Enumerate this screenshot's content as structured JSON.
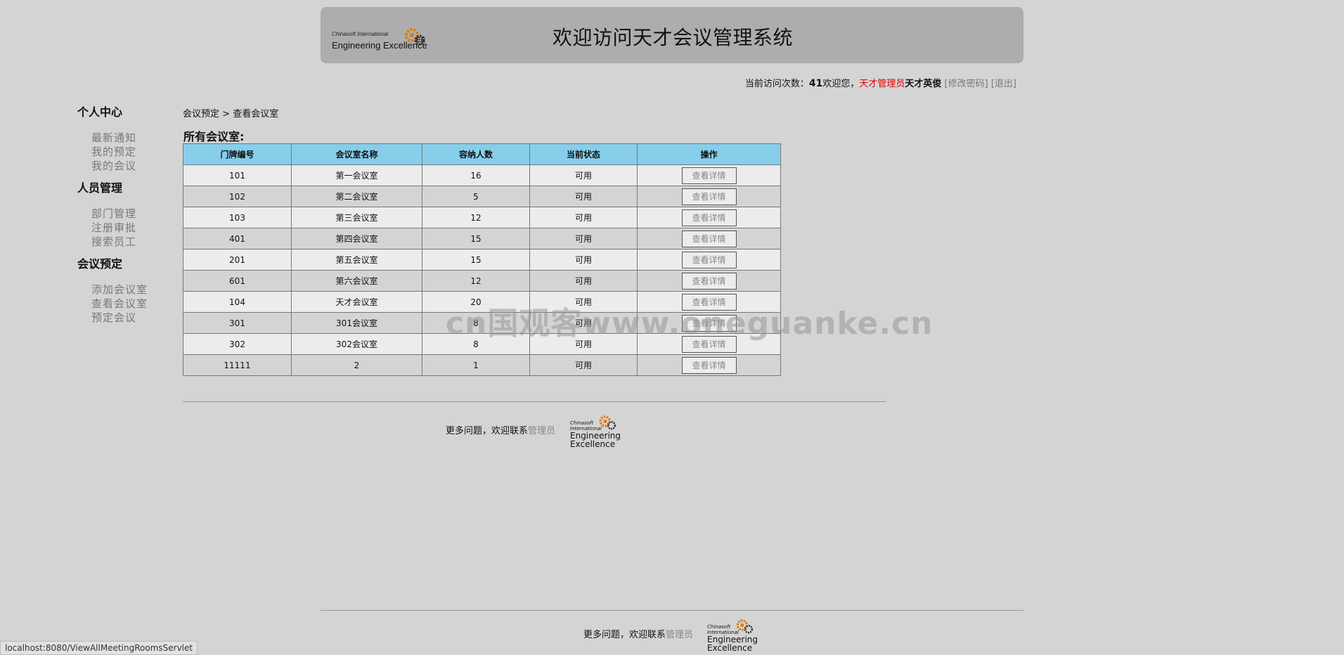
{
  "header": {
    "logo_line1": "Chinasoft International",
    "logo_line2": "Engineering Excellence",
    "title": "欢迎访问天才会议管理系统"
  },
  "status_line": {
    "visits_label": "当前访问次数：",
    "visits_count": "41",
    "welcome": "欢迎您，",
    "role": "天才管理员",
    "username": "天才英俊",
    "change_password": "[修改密码]",
    "logout": "[退出]"
  },
  "sidebar": {
    "groups": [
      {
        "title": "个人中心",
        "items": [
          "最新通知",
          "我的预定",
          "我的会议"
        ]
      },
      {
        "title": "人员管理",
        "items": [
          "部门管理",
          "注册审批",
          "搜索员工"
        ]
      },
      {
        "title": "会议预定",
        "items": [
          "添加会议室",
          "查看会议室",
          "预定会议"
        ]
      }
    ]
  },
  "breadcrumb": {
    "parent": "会议预定",
    "sep": " > ",
    "current": "查看会议室"
  },
  "section_title": "所有会议室:",
  "table": {
    "headers": [
      "门牌编号",
      "会议室名称",
      "容纳人数",
      "当前状态",
      "操作"
    ],
    "action_label": "查看详情",
    "rows": [
      {
        "no": "101",
        "name": "第一会议室",
        "cap": "16",
        "status": "可用"
      },
      {
        "no": "102",
        "name": "第二会议室",
        "cap": "5",
        "status": "可用"
      },
      {
        "no": "103",
        "name": "第三会议室",
        "cap": "12",
        "status": "可用"
      },
      {
        "no": "401",
        "name": "第四会议室",
        "cap": "15",
        "status": "可用"
      },
      {
        "no": "201",
        "name": "第五会议室",
        "cap": "15",
        "status": "可用"
      },
      {
        "no": "601",
        "name": "第六会议室",
        "cap": "12",
        "status": "可用"
      },
      {
        "no": "104",
        "name": "天才会议室",
        "cap": "20",
        "status": "可用"
      },
      {
        "no": "301",
        "name": "301会议室",
        "cap": "8",
        "status": "可用"
      },
      {
        "no": "302",
        "name": "302会议室",
        "cap": "8",
        "status": "可用"
      },
      {
        "no": "11111",
        "name": "2",
        "cap": "1",
        "status": "可用"
      }
    ]
  },
  "footer": {
    "text": "更多问题，欢迎联系",
    "admin_link": "管理员",
    "logo_line1": "Chinasoft International",
    "logo_line2a": "Engineering",
    "logo_line2b": "Excellence"
  },
  "watermark": "cn国观客www.oneguanke.cn",
  "browser_status": "localhost:8080/ViewAllMeetingRoomsServlet",
  "colors": {
    "page_bg": "#d4d4d4",
    "header_bg": "#adadad",
    "table_header": "#87ceeb",
    "role": "#e00000"
  },
  "icons": {
    "logo_gear": "gear-icon"
  }
}
